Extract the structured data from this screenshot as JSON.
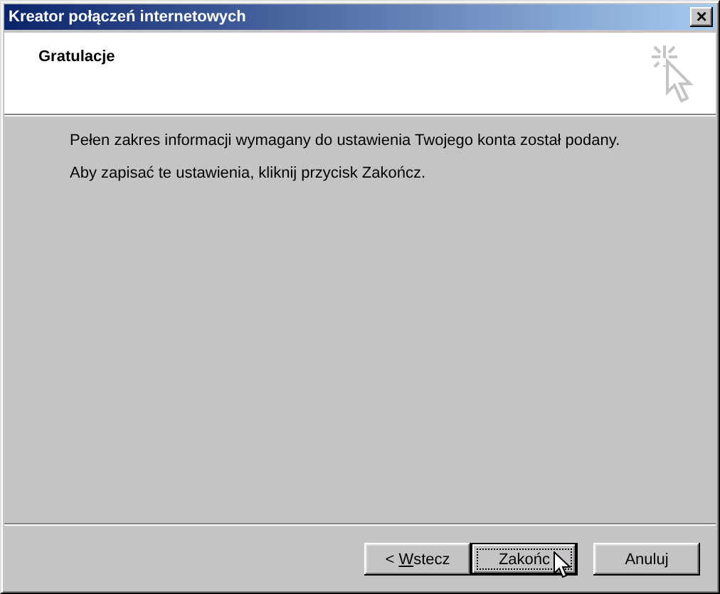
{
  "window": {
    "title": "Kreator połączeń internetowych",
    "close_button": "×"
  },
  "header": {
    "title": "Gratulacje"
  },
  "body": {
    "paragraphs": [
      "Pełen zakres informacji wymagany do ustawienia Twojego konta został podany.",
      "Aby zapisać te ustawienia, kliknij przycisk Zakończ."
    ]
  },
  "buttons": [
    {
      "label": "< ",
      "mnemonic": "W",
      "label_after": "stecz",
      "default": false
    },
    {
      "label": "Zakońc",
      "default": true
    },
    {
      "label": "Anuluj",
      "default": false
    }
  ]
}
